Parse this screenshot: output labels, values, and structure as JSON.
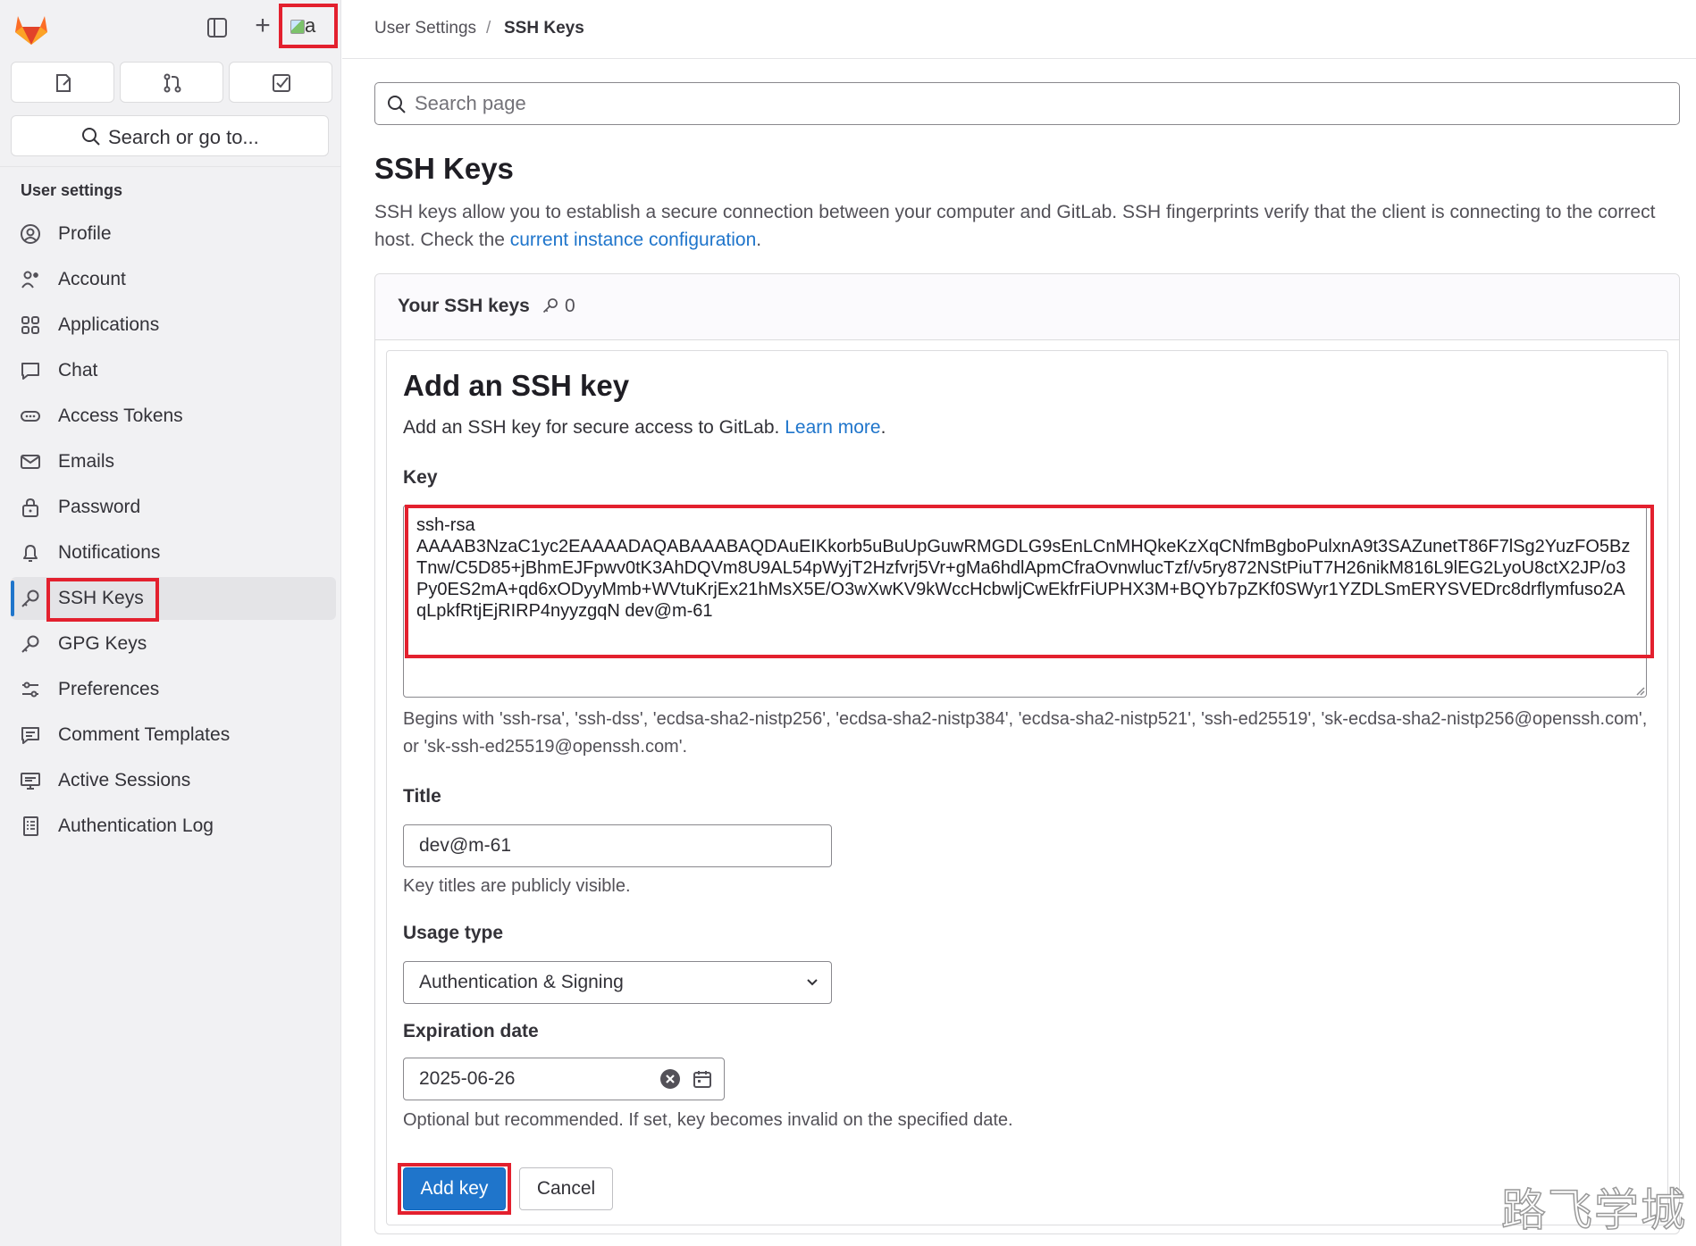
{
  "sidebar": {
    "search_label": "Search or go to...",
    "avatar_alt": "a",
    "section_heading": "User settings",
    "items": [
      {
        "label": "Profile",
        "icon": "profile-icon"
      },
      {
        "label": "Account",
        "icon": "account-icon"
      },
      {
        "label": "Applications",
        "icon": "applications-icon"
      },
      {
        "label": "Chat",
        "icon": "chat-icon"
      },
      {
        "label": "Access Tokens",
        "icon": "token-icon"
      },
      {
        "label": "Emails",
        "icon": "mail-icon"
      },
      {
        "label": "Password",
        "icon": "lock-icon"
      },
      {
        "label": "Notifications",
        "icon": "bell-icon"
      },
      {
        "label": "SSH Keys",
        "icon": "key-icon",
        "active": true
      },
      {
        "label": "GPG Keys",
        "icon": "key-icon"
      },
      {
        "label": "Preferences",
        "icon": "preferences-icon"
      },
      {
        "label": "Comment Templates",
        "icon": "comment-icon"
      },
      {
        "label": "Active Sessions",
        "icon": "monitor-icon"
      },
      {
        "label": "Authentication Log",
        "icon": "log-icon"
      }
    ]
  },
  "breadcrumb": {
    "parent": "User Settings",
    "separator": "/",
    "current": "SSH Keys"
  },
  "search_page": {
    "placeholder": "Search page"
  },
  "page": {
    "title": "SSH Keys",
    "description": "SSH keys allow you to establish a secure connection between your computer and GitLab. SSH fingerprints verify that the client is connecting to the correct host. Check the ",
    "description_link": "current instance configuration",
    "description_end": "."
  },
  "keys_card": {
    "title": "Your SSH keys",
    "count": "0"
  },
  "form": {
    "title": "Add an SSH key",
    "intro": "Add an SSH key for secure access to GitLab. ",
    "intro_link": "Learn more",
    "intro_end": ".",
    "key_label": "Key",
    "key_value": "ssh-rsa\nAAAAB3NzaC1yc2EAAAADAQABAAABAQDAuEIKkorb5uBuUpGuwRMGDLG9sEnLCnMHQkeKzXqCNfmBgboPulxnA9t3SAZunetT86F7lSg2YuzFO5BzTnw/C5D85+jBhmEJFpwv0tK3AhDQVm8U9AL54pWyjT2Hzfvrj5Vr+gMa6hdlApmCfraOvnwlucTzf/v5ry872NStPiuT7H26nikM816L9lEG2LyoU8ctX2JP/o3Py0ES2mA+qd6xODyyMmb+WVtuKrjEx21hMsX5E/O3wXwKV9kWccHcbwljCwEkfrFiUPHX3M+BQYb7pZKf0SWyr1YZDLSmERYSVEDrc8drflymfuso2AqLpkfRtjEjRIRP4nyyzgqN dev@m-61",
    "key_help": "Begins with 'ssh-rsa', 'ssh-dss', 'ecdsa-sha2-nistp256', 'ecdsa-sha2-nistp384', 'ecdsa-sha2-nistp521', 'ssh-ed25519', 'sk-ecdsa-sha2-nistp256@openssh.com', or 'sk-ssh-ed25519@openssh.com'.",
    "title_label": "Title",
    "title_value": "dev@m-61",
    "title_help": "Key titles are publicly visible.",
    "usage_label": "Usage type",
    "usage_value": "Authentication & Signing",
    "expiration_label": "Expiration date",
    "expiration_value": "2025-06-26",
    "expiration_help": "Optional but recommended. If set, key becomes invalid on the specified date.",
    "add_button": "Add key",
    "cancel_button": "Cancel"
  },
  "watermark": "路飞学城",
  "colors": {
    "accent": "#1f75cb",
    "highlight": "#e3202e",
    "logo": "#e24329"
  }
}
